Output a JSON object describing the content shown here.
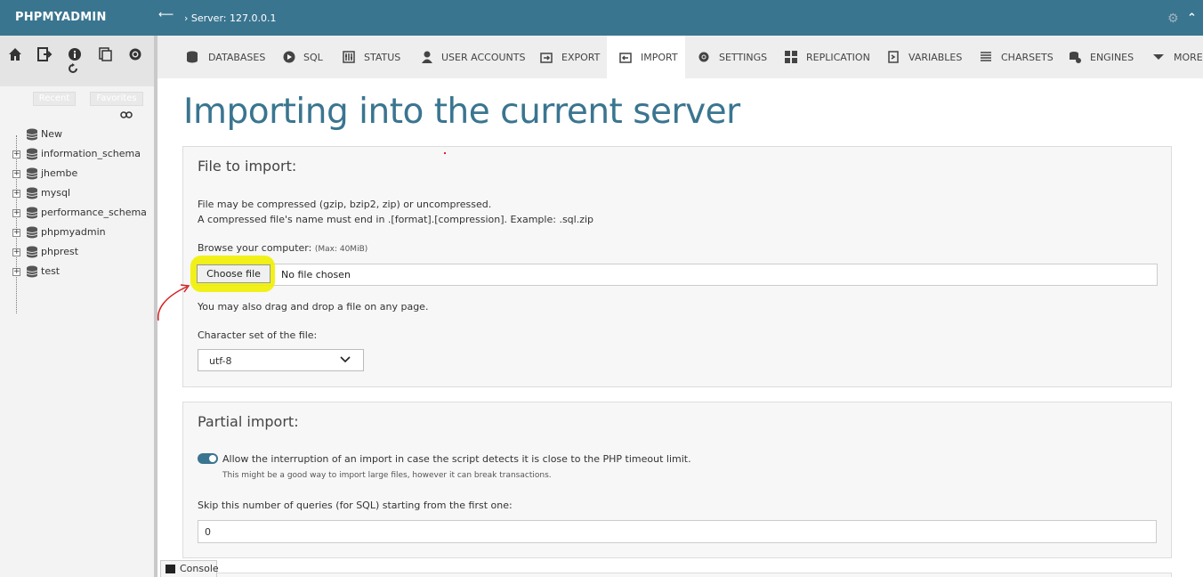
{
  "app": {
    "brand": "PHPMYADMIN"
  },
  "topbar": {
    "breadcrumb": "› Server: 127.0.0.1"
  },
  "sidebar": {
    "recent_label": "Recent",
    "favorites_label": "Favorites",
    "databases": [
      {
        "name": "New"
      },
      {
        "name": "information_schema"
      },
      {
        "name": "jhembe"
      },
      {
        "name": "mysql"
      },
      {
        "name": "performance_schema"
      },
      {
        "name": "phpmyadmin"
      },
      {
        "name": "phprest"
      },
      {
        "name": "test"
      }
    ]
  },
  "tabs": [
    {
      "label": "DATABASES",
      "icon": "database-icon"
    },
    {
      "label": "SQL",
      "icon": "sql-icon"
    },
    {
      "label": "STATUS",
      "icon": "status-icon"
    },
    {
      "label": "USER ACCOUNTS",
      "icon": "user-icon"
    },
    {
      "label": "EXPORT",
      "icon": "export-icon"
    },
    {
      "label": "IMPORT",
      "icon": "import-icon",
      "active": true
    },
    {
      "label": "SETTINGS",
      "icon": "gear-icon"
    },
    {
      "label": "REPLICATION",
      "icon": "replication-icon"
    },
    {
      "label": "VARIABLES",
      "icon": "variables-icon"
    },
    {
      "label": "CHARSETS",
      "icon": "charsets-icon"
    },
    {
      "label": "ENGINES",
      "icon": "engines-icon"
    },
    {
      "label": "MORE",
      "icon": "chevron-down-icon"
    }
  ],
  "main": {
    "title": "Importing into the current server",
    "file_panel": {
      "heading": "File to import:",
      "note_line1": "File may be compressed (gzip, bzip2, zip) or uncompressed.",
      "note_line2": "A compressed file's name must end in .[format].[compression]. Example: .sql.zip",
      "browse_label": "Browse your computer:",
      "max_size": "(Max: 40MiB)",
      "choose_button": "Choose file",
      "no_file_text": "No file chosen",
      "drag_note": "You may also drag and drop a file on any page.",
      "charset_label": "Character set of the file:",
      "charset_value": "utf-8"
    },
    "partial_panel": {
      "heading": "Partial import:",
      "allow_interrupt_label": "Allow the interruption of an import in case the script detects it is close to the PHP timeout limit.",
      "allow_interrupt_hint": "This might be a good way to import large files, however it can break transactions.",
      "allow_interrupt_on": true,
      "skip_label": "Skip this number of queries (for SQL) starting from the first one:",
      "skip_value": "0"
    }
  },
  "console": {
    "label": "Console"
  },
  "colors": {
    "accent": "#3a7590",
    "highlight": "#f0f000",
    "annotation": "#d22222"
  }
}
